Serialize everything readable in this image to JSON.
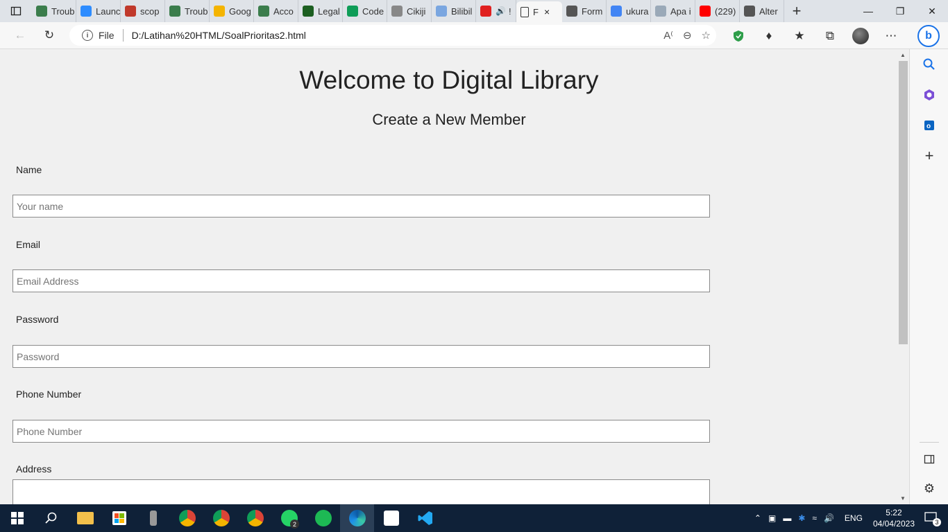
{
  "browser": {
    "tabs": [
      {
        "label": "Troub",
        "icon": "leaf-icon",
        "color": "#3b7d4c"
      },
      {
        "label": "Launc",
        "icon": "zoom-icon",
        "color": "#2d8cff"
      },
      {
        "label": "scop",
        "icon": "pdf-icon",
        "color": "#c0392b"
      },
      {
        "label": "Troub",
        "icon": "leaf-icon",
        "color": "#3b7d4c"
      },
      {
        "label": "Goog",
        "icon": "drive-icon",
        "color": "#f4b400"
      },
      {
        "label": "Acco",
        "icon": "leaf-icon",
        "color": "#3b7d4c"
      },
      {
        "label": "Legal",
        "icon": "leaf-icon",
        "color": "#1b5e20"
      },
      {
        "label": "Code",
        "icon": "plus-icon",
        "color": "#0f9d58"
      },
      {
        "label": "Cikiji",
        "icon": "chain-icon",
        "color": "#888888"
      },
      {
        "label": "Bilibil",
        "icon": "tv-icon",
        "color": "#7aa6e0"
      },
      {
        "label": "!",
        "icon": "record-icon",
        "color": "#e02020"
      }
    ],
    "active_tab": {
      "label": "F",
      "close": "×"
    },
    "tabs_after": [
      {
        "label": "Form",
        "icon": "page-icon",
        "color": "#555555"
      },
      {
        "label": "ukura",
        "icon": "google-icon",
        "color": "#4285f4"
      },
      {
        "label": "Apa i",
        "icon": "house-icon",
        "color": "#9aa9b8"
      },
      {
        "label": "(229)",
        "icon": "youtube-icon",
        "color": "#ff0000"
      },
      {
        "label": "Alter",
        "icon": "page-icon",
        "color": "#555555"
      }
    ],
    "newtab": "+",
    "url_scheme": "File",
    "url": "D:/Latihan%20HTML/SoalPrioritas2.html"
  },
  "page": {
    "title": "Welcome to Digital Library",
    "subtitle": "Create a New Member",
    "fields": [
      {
        "label": "Name",
        "placeholder": "Your name"
      },
      {
        "label": "Email",
        "placeholder": "Email Address"
      },
      {
        "label": "Password",
        "placeholder": "Password"
      },
      {
        "label": "Phone Number",
        "placeholder": "Phone Number"
      },
      {
        "label": "Address",
        "placeholder": ""
      }
    ]
  },
  "taskbar": {
    "whatsapp_badge": "2",
    "lang": "ENG",
    "time": "5:22",
    "date": "04/04/2023",
    "notifications": "3"
  }
}
